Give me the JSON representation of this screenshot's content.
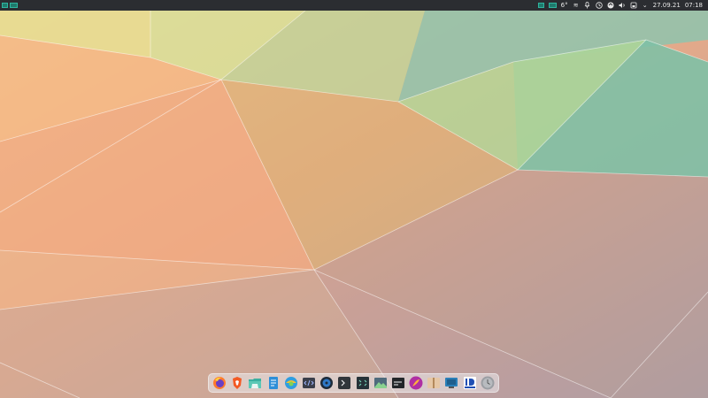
{
  "top_panel": {
    "weather": "6°",
    "date": "27.09.21",
    "time": "07:18"
  },
  "dock": {
    "apps": [
      "firefox-icon",
      "brave-icon",
      "file-manager-icon",
      "office-document-icon",
      "web-browser-icon",
      "code-editor-icon",
      "media-player-icon",
      "terminal-icon",
      "system-monitor-icon",
      "image-viewer-icon",
      "console-icon",
      "krita-icon",
      "archive-icon",
      "virtualbox-icon",
      "idm-icon",
      "clock-icon"
    ]
  },
  "colors": {
    "panel_bg": "#2b2d31",
    "accent_teal": "#1f7a6c"
  }
}
